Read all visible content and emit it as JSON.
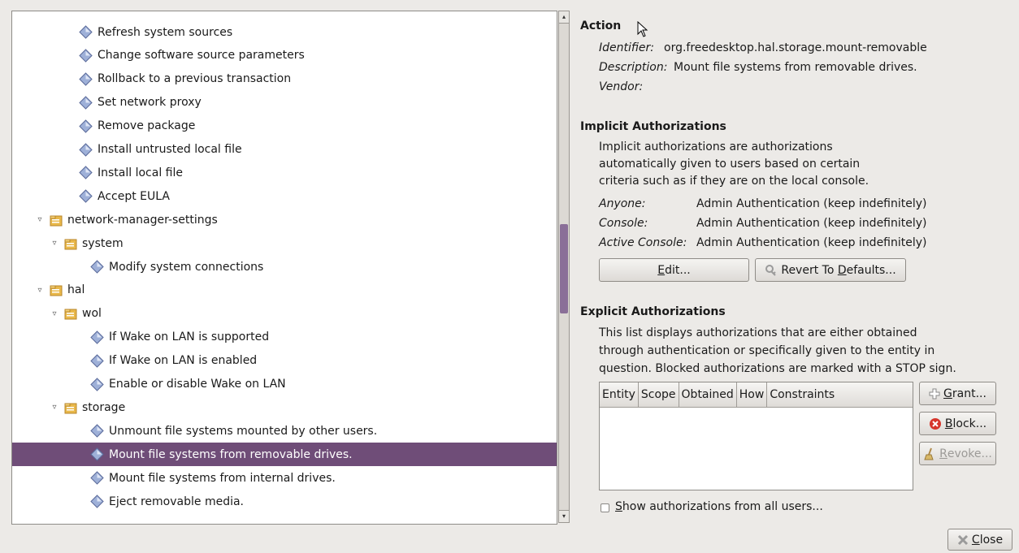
{
  "tree": {
    "rows": [
      {
        "label": "Refresh system sources",
        "indent": 2,
        "expander": "",
        "icon": "action"
      },
      {
        "label": "Change software source parameters",
        "indent": 2,
        "expander": "",
        "icon": "action"
      },
      {
        "label": "Rollback to a previous transaction",
        "indent": 2,
        "expander": "",
        "icon": "action"
      },
      {
        "label": "Set network proxy",
        "indent": 2,
        "expander": "",
        "icon": "action"
      },
      {
        "label": "Remove package",
        "indent": 2,
        "expander": "",
        "icon": "action"
      },
      {
        "label": "Install untrusted local file",
        "indent": 2,
        "expander": "",
        "icon": "action"
      },
      {
        "label": "Install local file",
        "indent": 2,
        "expander": "",
        "icon": "action"
      },
      {
        "label": "Accept EULA",
        "indent": 2,
        "expander": "",
        "icon": "action"
      },
      {
        "label": "network-manager-settings",
        "indent": 0,
        "expander": "▿",
        "icon": "folder"
      },
      {
        "label": "system",
        "indent": 1,
        "expander": "▿",
        "icon": "folder"
      },
      {
        "label": "Modify system connections",
        "indent": 3,
        "expander": "",
        "icon": "action"
      },
      {
        "label": "hal",
        "indent": 0,
        "expander": "▿",
        "icon": "folder"
      },
      {
        "label": "wol",
        "indent": 1,
        "expander": "▿",
        "icon": "folder"
      },
      {
        "label": "If Wake on LAN is supported",
        "indent": 3,
        "expander": "",
        "icon": "action"
      },
      {
        "label": "If Wake on LAN is enabled",
        "indent": 3,
        "expander": "",
        "icon": "action"
      },
      {
        "label": "Enable or disable Wake on LAN",
        "indent": 3,
        "expander": "",
        "icon": "action"
      },
      {
        "label": "storage",
        "indent": 1,
        "expander": "▿",
        "icon": "folder"
      },
      {
        "label": "Unmount file systems mounted by other users.",
        "indent": 3,
        "expander": "",
        "icon": "action"
      },
      {
        "label": "Mount file systems from removable drives.",
        "indent": 3,
        "expander": "",
        "icon": "action",
        "selected": true
      },
      {
        "label": "Mount file systems from internal drives.",
        "indent": 3,
        "expander": "",
        "icon": "action"
      },
      {
        "label": "Eject removable media.",
        "indent": 3,
        "expander": "",
        "icon": "action"
      }
    ]
  },
  "action": {
    "heading": "Action",
    "identifier_label": "Identifier:",
    "identifier_value": "org.freedesktop.hal.storage.mount-removable",
    "description_label": "Description:",
    "description_value": "Mount file systems from removable drives.",
    "vendor_label": "Vendor:"
  },
  "implicit": {
    "heading": "Implicit Authorizations",
    "text_1": "Implicit authorizations are authorizations",
    "text_2": "automatically given to users based on certain",
    "text_3": "criteria such as if they are on the local console.",
    "anyone_label": "Anyone:",
    "anyone_value": "Admin Authentication (keep indefinitely)",
    "console_label": "Console:",
    "console_value": "Admin Authentication (keep indefinitely)",
    "active_console_label": "Active Console:",
    "active_console_value": "Admin Authentication (keep indefinitely)",
    "edit_label_pre": "",
    "edit_label_mn": "E",
    "edit_label_post": "dit...",
    "revert_label_pre": "Revert To ",
    "revert_label_mn": "D",
    "revert_label_post": "efaults..."
  },
  "explicit": {
    "heading": "Explicit Authorizations",
    "text_1": "This list displays authorizations that are either obtained",
    "text_2": "through authentication or specifically given to the entity in",
    "text_3": "question. Blocked authorizations are marked with a STOP sign.",
    "columns": [
      "Entity",
      "Scope",
      "Obtained",
      "How",
      "Constraints"
    ],
    "grant_mn": "G",
    "grant_post": "rant...",
    "block_mn": "B",
    "block_post": "lock...",
    "revoke_mn": "R",
    "revoke_post": "evoke...",
    "show_all_mn": "S",
    "show_all_post": "how authorizations from all users..."
  },
  "footer": {
    "close_mn": "C",
    "close_post": "lose"
  },
  "colors": {
    "selection": "#6f4d78",
    "scroll_thumb": "#8a6f98"
  }
}
